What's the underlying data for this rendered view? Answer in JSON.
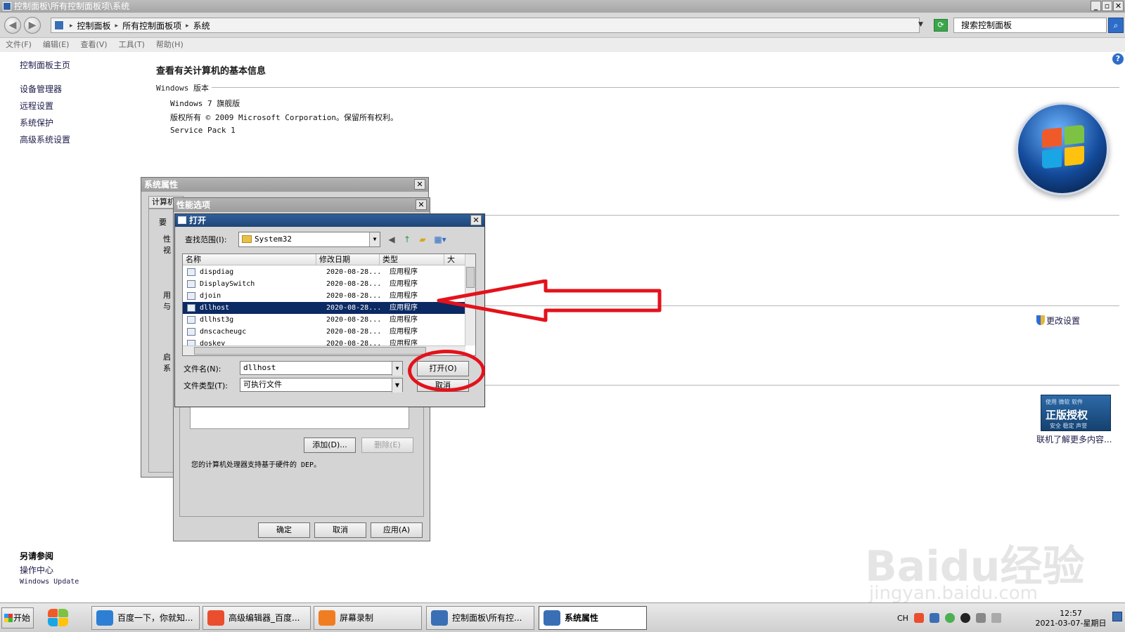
{
  "window": {
    "title": "控制面板\\所有控制面板项\\系统"
  },
  "address": {
    "crumbs": [
      "控制面板",
      "所有控制面板项",
      "系统"
    ],
    "search_placeholder": "搜索控制面板"
  },
  "menu": [
    "文件(F)",
    "编辑(E)",
    "查看(V)",
    "工具(T)",
    "帮助(H)"
  ],
  "left_panel": {
    "home": "控制面板主页",
    "links": [
      "设备管理器",
      "远程设置",
      "系统保护",
      "高级系统设置"
    ],
    "see_also": "另请参阅",
    "action_center": "操作中心",
    "windows_update": "Windows Update"
  },
  "main": {
    "title": "查看有关计算机的基本信息",
    "edition_heading": "Windows 版本",
    "edition": "Windows 7 旗舰版",
    "copyright": "版权所有 © 2009 Microsoft Corporation。保留所有权利。",
    "service_pack": "Service Pack 1",
    "change_settings": "更改设置",
    "genuine": {
      "top": "使用 微软 软件",
      "main": "正版授权",
      "sub": "安全 稳定 声誉"
    },
    "genuine_more": "联机了解更多内容..."
  },
  "sys_props": {
    "title": "系统属性",
    "tab": "计算机",
    "frag1": "要",
    "frag2": "性",
    "frag3": "视",
    "frag4": "用",
    "frag5": "与",
    "frag6": "启",
    "frag7": "系"
  },
  "perf_opts": {
    "title": "性能选项",
    "add": "添加(D)...",
    "remove": "删除(E)",
    "dep_note": "您的计算机处理器支持基于硬件的 DEP。",
    "ok": "确定",
    "cancel": "取消",
    "apply": "应用(A)"
  },
  "open_dialog": {
    "title": "打开",
    "look_in_label": "查找范围(I):",
    "look_in_value": "System32",
    "columns": [
      "名称",
      "修改日期",
      "类型",
      "大"
    ],
    "files": [
      {
        "name": "dispdiag",
        "date": "2020-08-28...",
        "type": "应用程序",
        "selected": false
      },
      {
        "name": "DisplaySwitch",
        "date": "2020-08-28...",
        "type": "应用程序",
        "selected": false
      },
      {
        "name": "djoin",
        "date": "2020-08-28...",
        "type": "应用程序",
        "selected": false
      },
      {
        "name": "dllhost",
        "date": "2020-08-28...",
        "type": "应用程序",
        "selected": true
      },
      {
        "name": "dllhst3g",
        "date": "2020-08-28...",
        "type": "应用程序",
        "selected": false
      },
      {
        "name": "dnscacheugc",
        "date": "2020-08-28...",
        "type": "应用程序",
        "selected": false
      },
      {
        "name": "doskey",
        "date": "2020-08-28...",
        "type": "应用程序",
        "selected": false
      }
    ],
    "filename_label": "文件名(N):",
    "filename_value": "dllhost",
    "filetype_label": "文件类型(T):",
    "filetype_value": "可执行文件",
    "open_button": "打开(O)",
    "cancel_button": "取消"
  },
  "watermark": {
    "main": "Baidu经验",
    "sub": "jingyan.baidu.com"
  },
  "taskbar": {
    "start": "开始",
    "tasks": [
      {
        "label": "百度一下，你就知...",
        "active": false,
        "color": "#2d7fd3"
      },
      {
        "label": "高级编辑器_百度...",
        "active": false,
        "color": "#e94f2f"
      },
      {
        "label": "屏幕录制",
        "active": false,
        "color": "#f07d22"
      },
      {
        "label": "控制面板\\所有控...",
        "active": false,
        "color": "#3a6fb5"
      },
      {
        "label": "系统属性",
        "active": true,
        "color": "#3a6fb5"
      }
    ],
    "lang": "CH",
    "time": "12:57",
    "date": "2021-03-07-星期日"
  }
}
